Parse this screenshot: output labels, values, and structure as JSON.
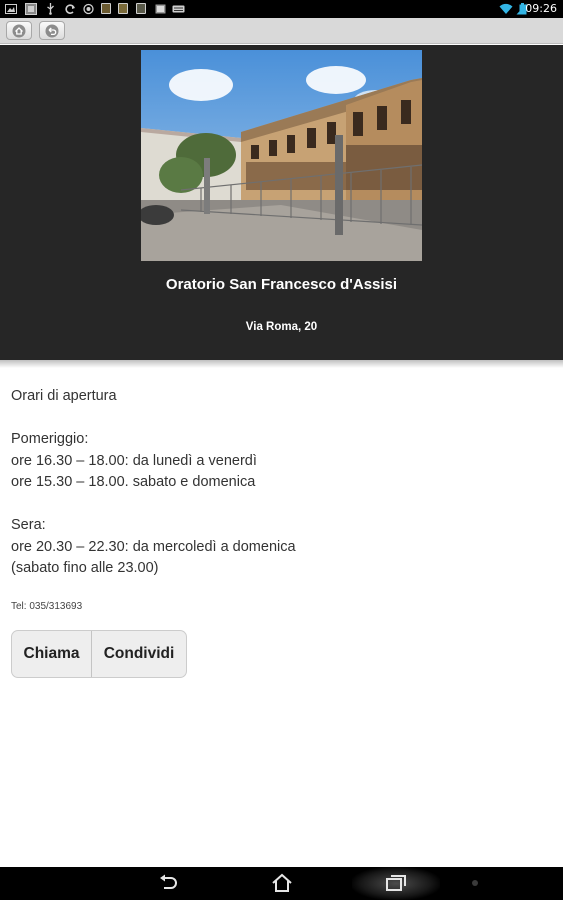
{
  "status_bar": {
    "time": "09:26",
    "left_icons": [
      "gallery-icon",
      "image-icon",
      "usb-icon",
      "sync-icon",
      "android-icon",
      "app-icon",
      "app-icon",
      "app-icon",
      "gallery-icon",
      "keyboard-icon"
    ],
    "right_icons": [
      "wifi-icon",
      "signal-icon",
      "battery-icon"
    ]
  },
  "nav": {
    "home_icon": "home-icon",
    "back_icon": "back-icon"
  },
  "place": {
    "title": "Oratorio San Francesco d'Assisi",
    "address": "Via Roma, 20"
  },
  "info": {
    "heading": "Orari di apertura",
    "afternoon_label": "Pomeriggio:",
    "afternoon_weekdays": "ore 16.30 – 18.00: da lunedì a venerdì",
    "afternoon_weekend": "ore 15.30 – 18.00. sabato e domenica",
    "evening_label": "Sera:",
    "evening_hours": "ore 20.30 – 22.30: da mercoledì a domenica",
    "evening_note": "(sabato fino alle 23.00)",
    "tel": "Tel: 035/313693"
  },
  "actions": {
    "call_label": "Chiama",
    "share_label": "Condividi"
  },
  "system_nav": {
    "back_icon": "back-icon",
    "home_icon": "home-icon",
    "recents_icon": "recents-icon",
    "menu_icon": "menu-dot-icon"
  },
  "colors": {
    "header_bg": "#262626",
    "nav_bg": "#d9d9d9",
    "button_bg": "#eeeeee",
    "wifi": "#33b5e5"
  }
}
